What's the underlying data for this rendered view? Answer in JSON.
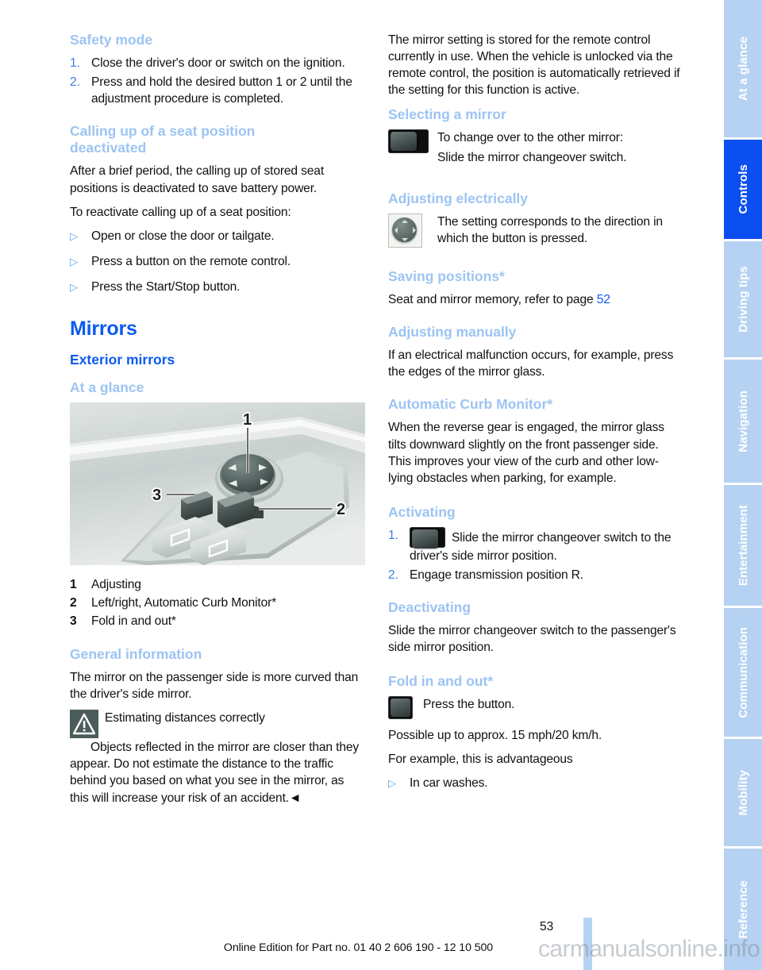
{
  "document": {
    "page_number": "53",
    "footer_text": "Online Edition for Part no. 01 40 2 606 190 - 12 10 500",
    "watermark": "carmanualsonline.info"
  },
  "colors": {
    "heading_strong": "#0b5bf0",
    "heading_light": "#9cc4f2",
    "tab_inactive": "#b6d2f2",
    "tab_active": "#0b4ff0",
    "body_text": "#12100f"
  },
  "left_column": {
    "safety_mode": {
      "heading": "Safety mode",
      "steps": [
        {
          "num": "1.",
          "text": "Close the driver's door or switch on the ignition."
        },
        {
          "num": "2.",
          "text": "Press and hold the desired button 1 or 2 until the adjustment procedure is completed."
        }
      ]
    },
    "calling_up": {
      "heading": "Calling up of a seat position deactivated",
      "para1": "After a brief period, the calling up of stored seat positions is deactivated to save battery power.",
      "para2": "To reactivate calling up of a seat position:",
      "bullets": [
        "Open or close the door or tailgate.",
        "Press a button on the remote control.",
        "Press the Start/Stop button."
      ]
    },
    "mirrors": {
      "title": "Mirrors",
      "subtitle": "Exterior mirrors",
      "at_a_glance": "At a glance",
      "figure_labels": {
        "one": "1",
        "two": "2",
        "three": "3"
      },
      "legend": [
        {
          "num": "1",
          "text": "Adjusting"
        },
        {
          "num": "2",
          "text": "Left/right, Automatic Curb Monitor*"
        },
        {
          "num": "3",
          "text": "Fold in and out*"
        }
      ]
    },
    "general_information": {
      "heading": "General information",
      "para1": "The mirror on the passenger side is more curved than the driver's side mirror.",
      "warning_title": "Estimating distances correctly",
      "warning_body": "Objects reflected in the mirror are closer than they appear. Do not estimate the distance to the traffic behind you based on what you see in the mirror, as this will increase your risk of an accident.◄"
    }
  },
  "right_column": {
    "intro_para": "The mirror setting is stored for the remote control currently in use. When the vehicle is unlocked via the remote control, the position is automatically retrieved if the setting for this function is active.",
    "selecting_a_mirror": {
      "heading": "Selecting a mirror",
      "line1": "To change over to the other mirror:",
      "line2": "Slide the mirror changeover switch."
    },
    "adjusting_electrically": {
      "heading": "Adjusting electrically",
      "text": "The setting corresponds to the direction in which the button is pressed."
    },
    "saving_positions": {
      "heading": "Saving positions*",
      "text_before": "Seat and mirror memory, refer to page ",
      "page_ref": "52"
    },
    "adjusting_manually": {
      "heading": "Adjusting manually",
      "text": "If an electrical malfunction occurs, for example, press the edges of the mirror glass."
    },
    "automatic_curb_monitor": {
      "heading": "Automatic Curb Monitor*",
      "text": "When the reverse gear is engaged, the mirror glass tilts downward slightly on the front passenger side. This improves your view of the curb and other low-lying obstacles when parking, for example."
    },
    "activating": {
      "heading": "Activating",
      "step1_num": "1.",
      "step1_text": "Slide the mirror changeover switch to the driver's side mirror position.",
      "step2_num": "2.",
      "step2_text": "Engage transmission position R."
    },
    "deactivating": {
      "heading": "Deactivating",
      "text": "Slide the mirror changeover switch to the passenger's side mirror position."
    },
    "fold_in_and_out": {
      "heading": "Fold in and out*",
      "press_text": "Press the button.",
      "para1": "Possible up to approx. 15 mph/20 km/h.",
      "para2": "For example, this is advantageous",
      "bullet1": "In car washes."
    }
  },
  "rail": {
    "tabs": [
      {
        "label": "At a glance",
        "active": false
      },
      {
        "label": "Controls",
        "active": true
      },
      {
        "label": "Driving tips",
        "active": false
      },
      {
        "label": "Navigation",
        "active": false
      },
      {
        "label": "Entertainment",
        "active": false
      },
      {
        "label": "Communication",
        "active": false
      },
      {
        "label": "Mobility",
        "active": false
      },
      {
        "label": "Reference",
        "active": false
      }
    ]
  }
}
